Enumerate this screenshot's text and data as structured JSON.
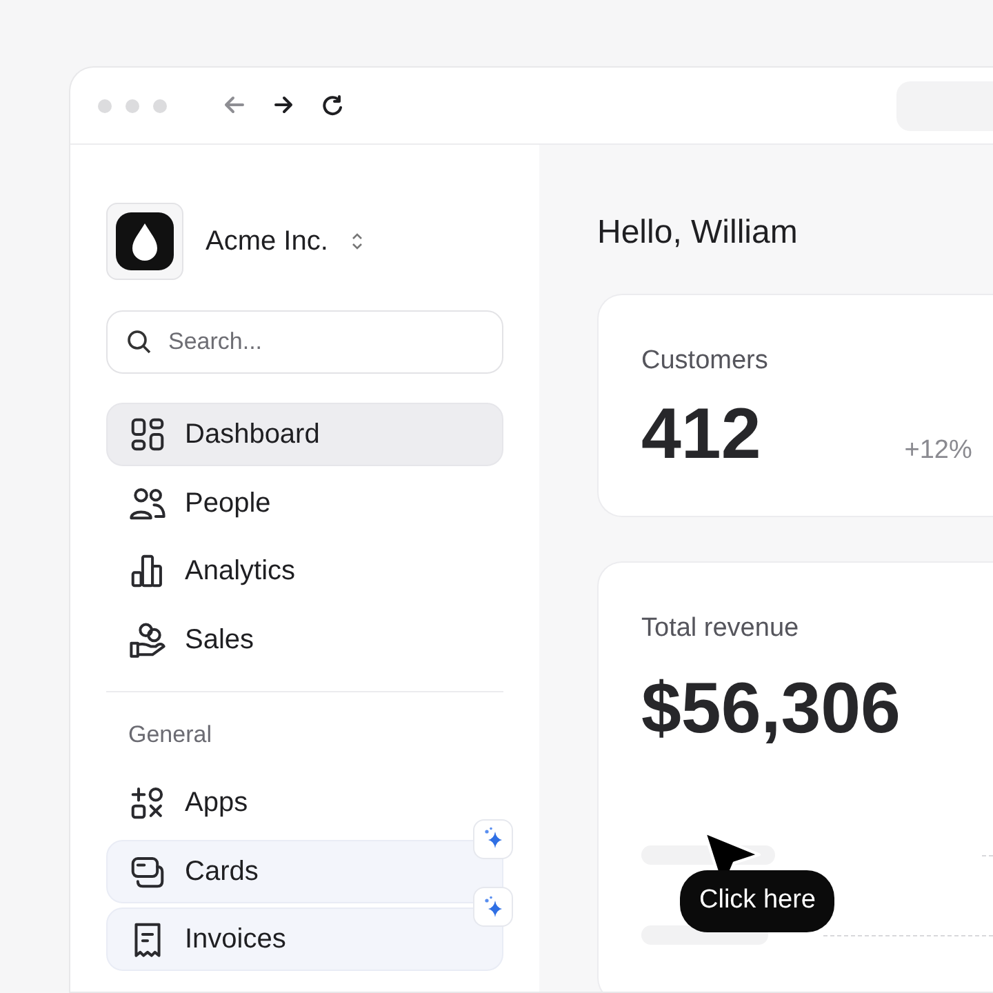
{
  "browser": {
    "nav_buttons": [
      {
        "kind": "back",
        "disabled": true
      },
      {
        "kind": "forward",
        "disabled": false
      },
      {
        "kind": "reload",
        "disabled": false
      }
    ]
  },
  "sidebar": {
    "workspace": "Acme Inc.",
    "search": {
      "placeholder": "Search..."
    },
    "items": [
      {
        "label": "Dashboard",
        "selected": true,
        "highlighted": false
      },
      {
        "label": "People",
        "selected": false,
        "highlighted": false
      },
      {
        "label": "Analytics",
        "selected": false,
        "highlighted": false
      },
      {
        "label": "Sales",
        "selected": false,
        "highlighted": false
      }
    ],
    "section_title": "General",
    "general_items": [
      {
        "label": "Apps",
        "selected": false,
        "highlighted": false
      },
      {
        "label": "Cards",
        "selected": false,
        "highlighted": true
      },
      {
        "label": "Invoices",
        "selected": false,
        "highlighted": true
      }
    ]
  },
  "main": {
    "greeting": "Hello, William",
    "cards": [
      {
        "label": "Customers",
        "value": "412",
        "change": "+12%"
      },
      {
        "label": "Total revenue",
        "value": "$56,306"
      }
    ]
  },
  "tooltip": "Click here"
}
